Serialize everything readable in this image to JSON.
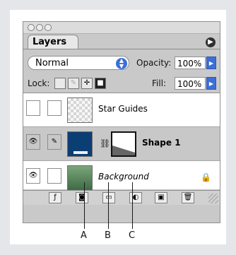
{
  "panel": {
    "tab_label": "Layers",
    "menu_icon": "triangle-right",
    "blend_mode": "Normal",
    "opacity_label": "Opacity:",
    "opacity_value": "100%",
    "lock_label": "Lock:",
    "fill_label": "Fill:",
    "fill_value": "100%"
  },
  "layers": [
    {
      "name": "Star Guides",
      "visible": false
    },
    {
      "name": "Shape 1",
      "visible": true,
      "selected": true,
      "has_vector_mask": true
    },
    {
      "name": "Background",
      "visible": true,
      "locked": true
    }
  ],
  "callouts": [
    "A",
    "B",
    "C"
  ]
}
